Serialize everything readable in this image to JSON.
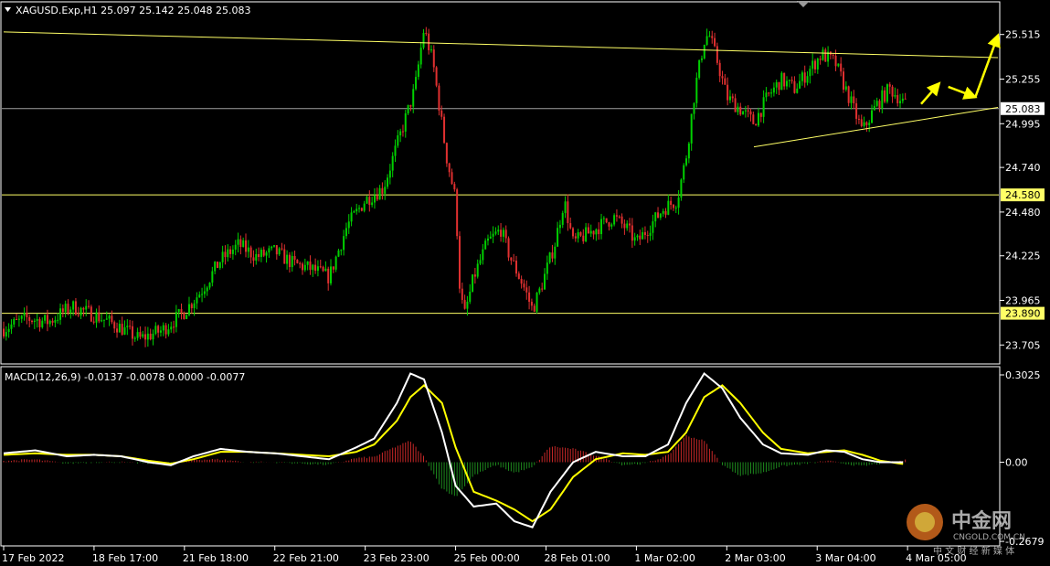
{
  "header": {
    "symbol_line": "XAGUSD.Exp,H1  25.097 25.142 25.048 25.083",
    "macd_line": "MACD(12,26,9) -0.0137 -0.0078 0.0000 -0.0077"
  },
  "colors": {
    "background": "#000000",
    "bull_candle": "#00d000",
    "bear_candle": "#e03030",
    "hline": "#ffff66",
    "arrow": "#ffff00",
    "macd_line": "#ffffff",
    "signal_line": "#ffff00",
    "hist_pos": "#c82828",
    "hist_neg": "#1e8c1e"
  },
  "watermark": {
    "brand": "中金网",
    "domain": "CNGOLD.COM.CN",
    "tagline": "中 文 财 经 新 媒 体"
  },
  "chart_data": [
    {
      "type": "candlestick",
      "title": "XAGUSD.Exp,H1",
      "ylim": [
        23.6,
        25.7
      ],
      "y_ticks": [
        "25.515",
        "25.255",
        "24.995",
        "24.740",
        "24.480",
        "24.225",
        "23.965",
        "23.705"
      ],
      "x_ticks": [
        "17 Feb 2022",
        "18 Feb 17:00",
        "21 Feb 18:00",
        "22 Feb 21:00",
        "23 Feb 23:00",
        "25 Feb 00:00",
        "28 Feb 01:00",
        "1 Mar 02:00",
        "2 Mar 03:00",
        "3 Mar 04:00",
        "4 Mar 05:00"
      ],
      "current_price": "25.083",
      "horizontal_levels": [
        "24.580",
        "23.890"
      ],
      "trendlines": [
        {
          "name": "upper",
          "from": [
            0,
            25.53
          ],
          "to": [
            11,
            25.38
          ]
        },
        {
          "name": "lower",
          "from": [
            8.3,
            24.86
          ],
          "to": [
            11,
            25.09
          ]
        }
      ],
      "closes_path": [
        [
          0.0,
          23.8
        ],
        [
          0.25,
          23.86
        ],
        [
          0.5,
          23.84
        ],
        [
          0.75,
          23.93
        ],
        [
          1.0,
          23.88
        ],
        [
          1.25,
          23.82
        ],
        [
          1.5,
          23.74
        ],
        [
          1.75,
          23.79
        ],
        [
          2.0,
          23.9
        ],
        [
          2.2,
          24.03
        ],
        [
          2.4,
          24.2
        ],
        [
          2.6,
          24.29
        ],
        [
          2.8,
          24.22
        ],
        [
          3.0,
          24.25
        ],
        [
          3.2,
          24.18
        ],
        [
          3.4,
          24.15
        ],
        [
          3.6,
          24.1
        ],
        [
          3.8,
          24.4
        ],
        [
          4.0,
          24.55
        ],
        [
          4.2,
          24.62
        ],
        [
          4.4,
          24.95
        ],
        [
          4.55,
          25.2
        ],
        [
          4.65,
          25.55
        ],
        [
          4.75,
          25.35
        ],
        [
          4.9,
          24.8
        ],
        [
          5.0,
          24.55
        ],
        [
          5.05,
          24.0
        ],
        [
          5.1,
          23.88
        ],
        [
          5.2,
          24.1
        ],
        [
          5.35,
          24.3
        ],
        [
          5.5,
          24.38
        ],
        [
          5.6,
          24.22
        ],
        [
          5.75,
          24.05
        ],
        [
          5.85,
          23.91
        ],
        [
          5.95,
          24.05
        ],
        [
          6.1,
          24.3
        ],
        [
          6.2,
          24.55
        ],
        [
          6.3,
          24.3
        ],
        [
          6.45,
          24.35
        ],
        [
          6.6,
          24.4
        ],
        [
          6.75,
          24.45
        ],
        [
          6.9,
          24.38
        ],
        [
          7.0,
          24.3
        ],
        [
          7.15,
          24.4
        ],
        [
          7.3,
          24.5
        ],
        [
          7.45,
          24.55
        ],
        [
          7.55,
          24.8
        ],
        [
          7.65,
          25.2
        ],
        [
          7.75,
          25.48
        ],
        [
          7.8,
          25.52
        ],
        [
          7.9,
          25.35
        ],
        [
          8.0,
          25.15
        ],
        [
          8.15,
          25.08
        ],
        [
          8.3,
          25.0
        ],
        [
          8.45,
          25.15
        ],
        [
          8.6,
          25.25
        ],
        [
          8.75,
          25.2
        ],
        [
          8.9,
          25.3
        ],
        [
          9.05,
          25.4
        ],
        [
          9.2,
          25.35
        ],
        [
          9.35,
          25.15
        ],
        [
          9.5,
          24.95
        ],
        [
          9.65,
          25.1
        ],
        [
          9.8,
          25.2
        ],
        [
          9.9,
          25.15
        ],
        [
          10.0,
          25.09
        ]
      ],
      "projection_arrows": [
        [
          [
            10.15,
            25.11
          ],
          [
            10.35,
            25.23
          ]
        ],
        [
          [
            10.45,
            25.21
          ],
          [
            10.75,
            25.15
          ]
        ],
        [
          [
            10.75,
            25.15
          ],
          [
            11.0,
            25.51
          ]
        ]
      ]
    },
    {
      "type": "macd",
      "title": "MACD(12,26,9)",
      "params": [
        12,
        26,
        9
      ],
      "values": {
        "macd": -0.0137,
        "signal": -0.0078,
        "hist": -0.0077
      },
      "ylim": [
        -0.28,
        0.32
      ],
      "y_ticks": [
        "0.3025",
        "0.00",
        "-0.2679"
      ],
      "macd_path": [
        [
          0.0,
          0.03
        ],
        [
          0.35,
          0.04
        ],
        [
          0.7,
          0.02
        ],
        [
          1.0,
          0.025
        ],
        [
          1.3,
          0.02
        ],
        [
          1.6,
          0.0
        ],
        [
          1.85,
          -0.01
        ],
        [
          2.1,
          0.02
        ],
        [
          2.4,
          0.045
        ],
        [
          2.7,
          0.035
        ],
        [
          3.0,
          0.03
        ],
        [
          3.3,
          0.02
        ],
        [
          3.6,
          0.01
        ],
        [
          3.9,
          0.05
        ],
        [
          4.1,
          0.08
        ],
        [
          4.35,
          0.2
        ],
        [
          4.5,
          0.3
        ],
        [
          4.65,
          0.28
        ],
        [
          4.85,
          0.1
        ],
        [
          5.0,
          -0.08
        ],
        [
          5.2,
          -0.15
        ],
        [
          5.45,
          -0.14
        ],
        [
          5.65,
          -0.2
        ],
        [
          5.85,
          -0.22
        ],
        [
          6.05,
          -0.1
        ],
        [
          6.3,
          0.0
        ],
        [
          6.55,
          0.035
        ],
        [
          6.85,
          0.02
        ],
        [
          7.1,
          0.02
        ],
        [
          7.35,
          0.06
        ],
        [
          7.55,
          0.2
        ],
        [
          7.75,
          0.3
        ],
        [
          7.95,
          0.25
        ],
        [
          8.15,
          0.15
        ],
        [
          8.4,
          0.06
        ],
        [
          8.6,
          0.03
        ],
        [
          8.9,
          0.025
        ],
        [
          9.1,
          0.04
        ],
        [
          9.3,
          0.035
        ],
        [
          9.5,
          0.01
        ],
        [
          9.7,
          0.0
        ],
        [
          10.0,
          0.0
        ]
      ],
      "signal_path": [
        [
          0.0,
          0.025
        ],
        [
          0.35,
          0.03
        ],
        [
          0.7,
          0.025
        ],
        [
          1.0,
          0.025
        ],
        [
          1.3,
          0.02
        ],
        [
          1.6,
          0.005
        ],
        [
          1.85,
          -0.005
        ],
        [
          2.1,
          0.01
        ],
        [
          2.4,
          0.035
        ],
        [
          2.7,
          0.035
        ],
        [
          3.0,
          0.03
        ],
        [
          3.3,
          0.025
        ],
        [
          3.6,
          0.02
        ],
        [
          3.9,
          0.035
        ],
        [
          4.1,
          0.06
        ],
        [
          4.35,
          0.14
        ],
        [
          4.5,
          0.22
        ],
        [
          4.65,
          0.26
        ],
        [
          4.85,
          0.2
        ],
        [
          5.0,
          0.05
        ],
        [
          5.2,
          -0.1
        ],
        [
          5.45,
          -0.13
        ],
        [
          5.65,
          -0.16
        ],
        [
          5.85,
          -0.2
        ],
        [
          6.05,
          -0.16
        ],
        [
          6.3,
          -0.05
        ],
        [
          6.55,
          0.01
        ],
        [
          6.85,
          0.03
        ],
        [
          7.1,
          0.025
        ],
        [
          7.35,
          0.035
        ],
        [
          7.55,
          0.1
        ],
        [
          7.75,
          0.22
        ],
        [
          7.95,
          0.26
        ],
        [
          8.15,
          0.2
        ],
        [
          8.4,
          0.1
        ],
        [
          8.6,
          0.045
        ],
        [
          8.9,
          0.03
        ],
        [
          9.1,
          0.035
        ],
        [
          9.3,
          0.04
        ],
        [
          9.5,
          0.025
        ],
        [
          9.7,
          0.005
        ],
        [
          10.0,
          -0.008
        ]
      ]
    }
  ]
}
